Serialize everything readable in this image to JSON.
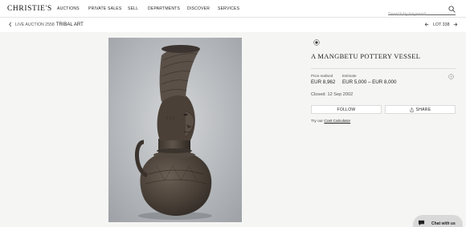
{
  "header": {
    "logo": "CHRISTIE'S",
    "nav": [
      "AUCTIONS",
      "PRIVATE SALES",
      "SELL",
      "DEPARTMENTS",
      "DISCOVER",
      "SERVICES"
    ],
    "search_placeholder": "Search by keyword"
  },
  "subbar": {
    "back_sale": "LIVE AUCTION 2558",
    "back_category": "TRIBAL ART",
    "lot_label": "LOT 338"
  },
  "lot": {
    "title": "A MANGBETU POTTERY VESSEL",
    "price_realized_label": "Price realised",
    "price_realized": "EUR 8,962",
    "estimate_label": "Estimate",
    "estimate": "EUR 5,000 – EUR 8,000",
    "closed": "Closed: 12 Sep 2002",
    "follow_label": "FOLLOW",
    "share_label": "SHARE",
    "calc_prefix": "Try our",
    "calc_link": "Cost Calculator"
  },
  "chat": {
    "label": "Chat with us"
  },
  "colors": {
    "background": "#ffffff",
    "image_background": "#f5f5f3",
    "text": "#222222",
    "chat_bubble": "#d9d9d9"
  }
}
